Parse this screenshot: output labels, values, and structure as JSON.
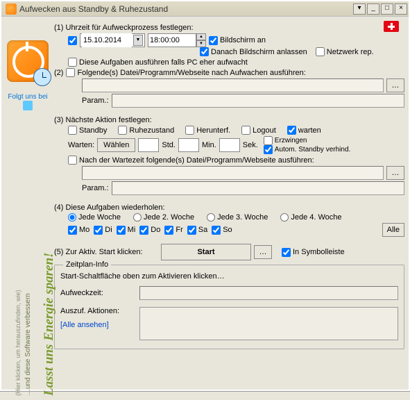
{
  "window": {
    "title": "Aufwecken aus Standby & Ruhezustand"
  },
  "plus_icon": "plus-icon",
  "s1": {
    "label": "(1) Uhrzeit für Aufweckprozess festlegen:",
    "date_value": "15.10.2014",
    "time_value": "18:00:00",
    "cb_screen_on": "Bildschirm an",
    "cb_screen_stay": "Danach Bildschirm anlassen",
    "cb_network": "Netzwerk rep.",
    "cb_earlier": "Diese Aufgaben ausführen falls PC eher aufwacht"
  },
  "s2": {
    "label": "(2)",
    "cb_label": "Folgende(s) Datei/Programm/Webseite nach Aufwachen ausführen:",
    "param_label": "Param.:"
  },
  "s3": {
    "label": "(3) Nächste Aktion festlegen:",
    "standby": "Standby",
    "hibernate": "Ruhezustand",
    "shutdown": "Herunterf.",
    "logout": "Logout",
    "wait": "warten",
    "wait_label": "Warten:",
    "choose": "Wählen",
    "h": "Std.",
    "m": "Min.",
    "s": "Sek.",
    "force": "Erzwingen",
    "autostandby": "Autom. Standby verhind.",
    "after_wait": "Nach der Wartezeit folgende(s) Datei/Programm/Webseite ausführen:",
    "param_label": "Param.:"
  },
  "s4": {
    "label": "(4) Diese Aufgaben wiederholen:",
    "w1": "Jede Woche",
    "w2": "Jede 2. Woche",
    "w3": "Jede 3. Woche",
    "w4": "Jede 4. Woche",
    "mo": "Mo",
    "di": "Di",
    "mi": "Mi",
    "do": "Do",
    "fr": "Fr",
    "sa": "Sa",
    "so": "So",
    "all": "Alle"
  },
  "s5": {
    "label": "(5) Zur Aktiv. Start klicken:",
    "start": "Start",
    "tray": "In Symbolleiste"
  },
  "info": {
    "legend": "Zeitplan-Info",
    "hint": "Start-Schaltfläche oben zum Aktivieren klicken…",
    "wake_label": "Aufweckzeit:",
    "actions_label": "Auszuf. Aktionen:",
    "view_all": "[Alle ansehen]"
  },
  "side": {
    "follow": "Folgt uns bei",
    "main": "Lasst uns Energie sparen!",
    "sub": "…und diese Software verbessern",
    "sub2": "(Hier klicken, um herauszufinden, wie)"
  }
}
